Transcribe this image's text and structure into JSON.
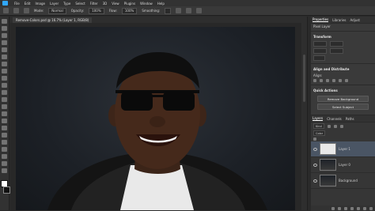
{
  "menubar": {
    "items": [
      "File",
      "Edit",
      "Image",
      "Layer",
      "Type",
      "Select",
      "Filter",
      "3D",
      "View",
      "Plugins",
      "Window",
      "Help"
    ]
  },
  "options": {
    "mode_label": "Mode:",
    "mode_value": "Normal",
    "opacity_label": "Opacity:",
    "opacity_value": "100%",
    "flow_label": "Flow:",
    "flow_value": "100%",
    "smoothing_label": "Smoothing:"
  },
  "document": {
    "tab_title": "Remove-Colors.psd @ 16.7% (Layer 1, RGB/8)"
  },
  "panel": {
    "tabs": [
      "Properties",
      "Libraries",
      "Adjust"
    ],
    "pixel_layer_label": "Pixel Layer",
    "transform_title": "Transform",
    "align_title": "Align and Distribute",
    "align_sub": "Align:",
    "quick_actions_title": "Quick Actions",
    "remove_bg_label": "Remove Background",
    "select_subject_label": "Select Subject"
  },
  "layers": {
    "tabs": [
      "Layers",
      "Channels",
      "Paths"
    ],
    "kind_label": "Kind",
    "blend_label": "Color",
    "items": [
      {
        "name": "Layer 1"
      },
      {
        "name": "Layer 0"
      },
      {
        "name": "Background"
      }
    ]
  }
}
